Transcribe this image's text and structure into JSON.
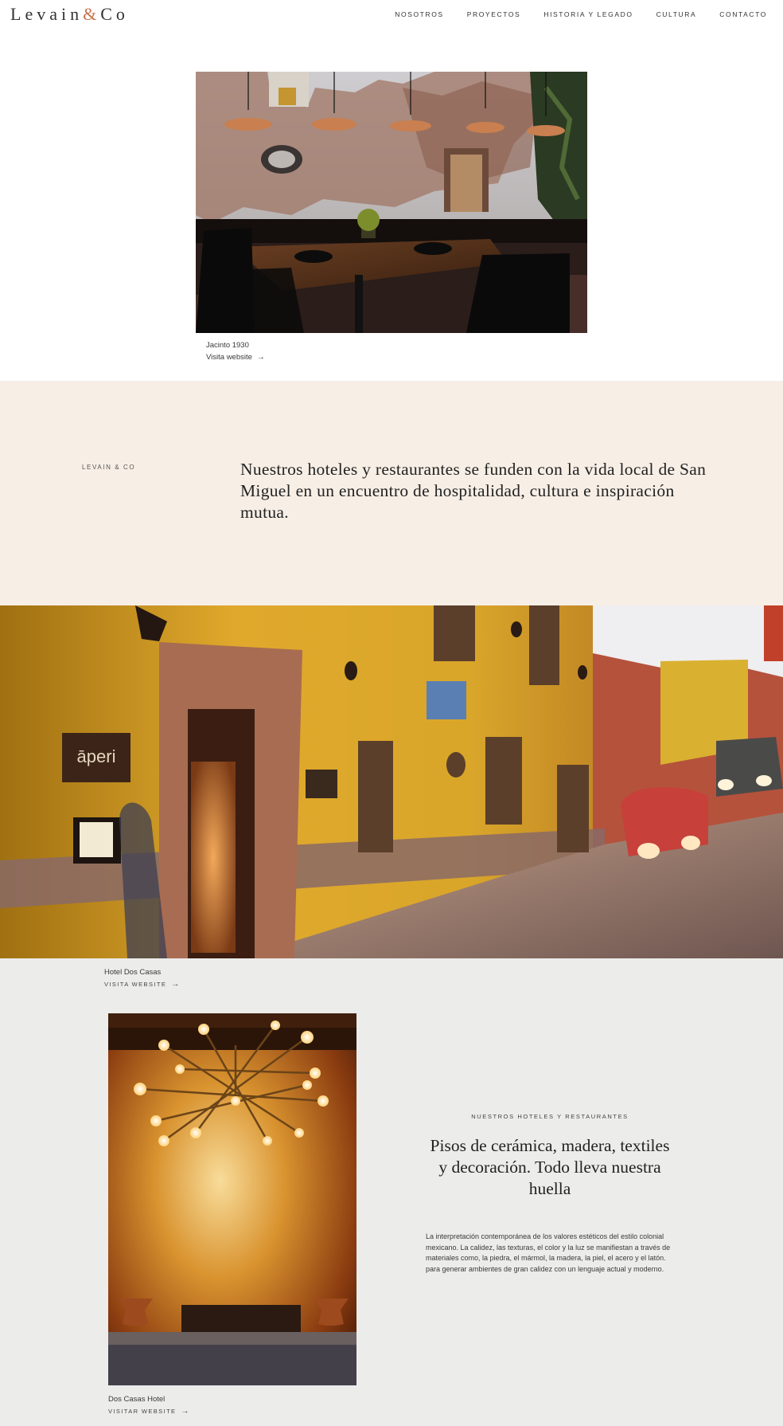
{
  "header": {
    "logo": {
      "part1": "Levain",
      "amp": "&",
      "part2": "Co"
    },
    "nav": [
      "NOSOTROS",
      "PROYECTOS",
      "HISTORIA Y LEGADO",
      "CULTURA",
      "CONTACTO"
    ]
  },
  "project1": {
    "title": "Jacinto 1930",
    "link": "Visita website",
    "arrow": "→"
  },
  "intro": {
    "label": "LEVAIN & CO",
    "text": "Nuestros hoteles y restaurantes se funden con la vida local de San Miguel en un encuentro de hospitalidad, cultura e inspiración mutua."
  },
  "project2": {
    "title": "Hotel Dos Casas",
    "link": "VISITA WEBSITE",
    "arrow": "→",
    "sign": "āperi"
  },
  "project3": {
    "title": "Dos Casas Hotel",
    "link": "VISITAR WEBSITE",
    "arrow": "→"
  },
  "feature": {
    "label": "NUESTROS HOTELES Y RESTAURANTES",
    "title": "Pisos de cerámica, madera, textiles y decoración. Todo lleva nuestra huella",
    "body": "La interpretación contemporánea de los valores estéticos del estilo colonial mexicano. La calidez, las texturas, el color y la luz se manifiestan a través de materiales como, la piedra, el mármol, la madera, la piel, el acero y el latón. para generar ambientes de gran calidez con un lenguaje actual y moderno."
  },
  "colors": {
    "accent": "#c8744f",
    "beige": "#f7efe6",
    "gray": "#ececea"
  }
}
